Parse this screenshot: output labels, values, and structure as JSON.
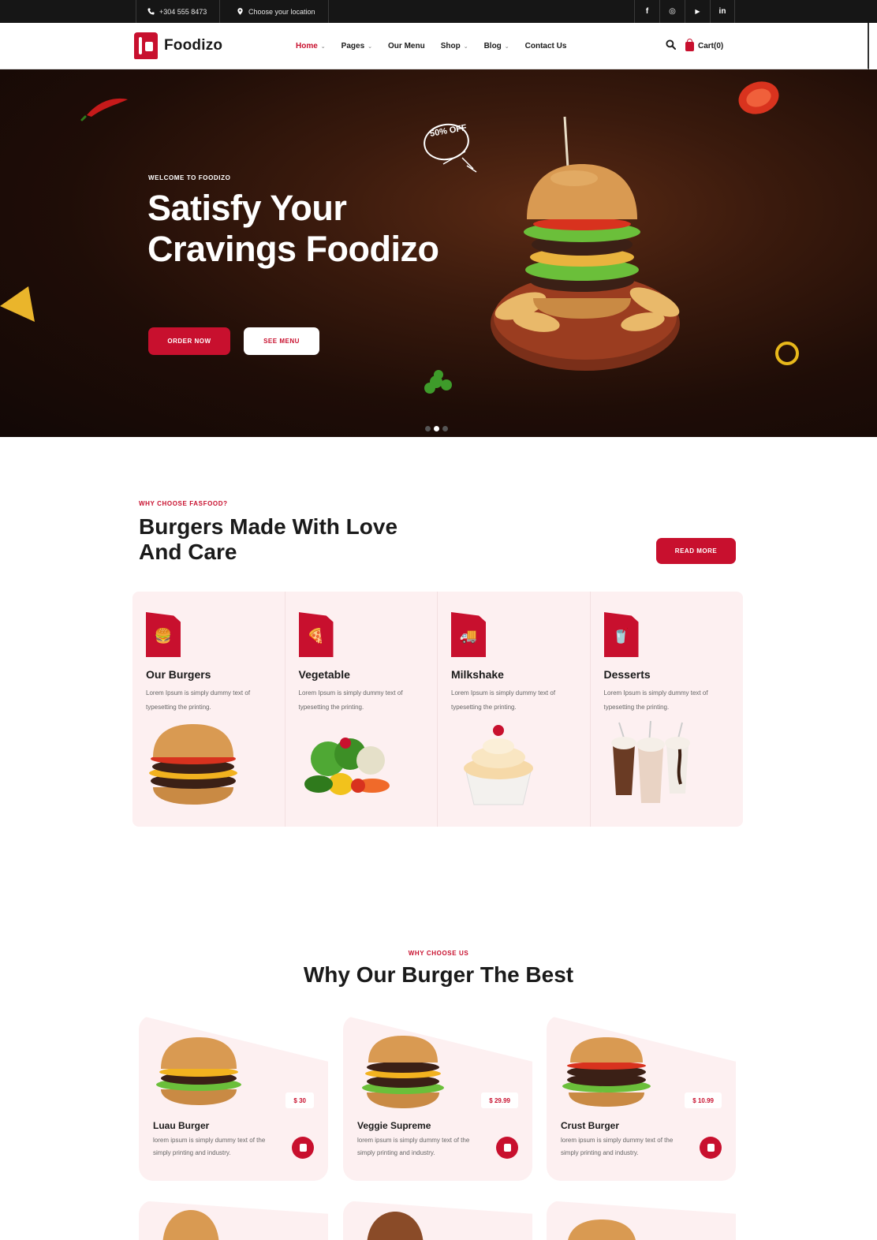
{
  "topbar": {
    "phone": "+304 555 8473",
    "location": "Choose your location",
    "socials": [
      {
        "icon": "facebook-icon",
        "glyph": "f"
      },
      {
        "icon": "instagram-icon",
        "glyph": "◎"
      },
      {
        "icon": "youtube-icon",
        "glyph": "▶"
      },
      {
        "icon": "linkedin-icon",
        "glyph": "in"
      }
    ]
  },
  "nav": {
    "brand": "Foodizo",
    "items": [
      {
        "label": "Home",
        "dropdown": true,
        "active": true
      },
      {
        "label": "Pages",
        "dropdown": true,
        "active": false
      },
      {
        "label": "Our Menu",
        "dropdown": false,
        "active": false
      },
      {
        "label": "Shop",
        "dropdown": true,
        "active": false
      },
      {
        "label": "Blog",
        "dropdown": true,
        "active": false
      },
      {
        "label": "Contact Us",
        "dropdown": false,
        "active": false
      }
    ],
    "cart_label": "Cart(0)"
  },
  "hero": {
    "tagline": "WELCOME TO FOODIZO",
    "title": "Satisfy Your Cravings Foodizo",
    "order_button": "ORDER NOW",
    "menu_button": "SEE MENU",
    "badge": "50% OFF",
    "slides": 3,
    "active_slide": 2
  },
  "why_choose": {
    "tagline": "WHY CHOOSE FASFOOD?",
    "title": "Burgers Made With Love And Care",
    "read_more": "READ MORE",
    "categories": [
      {
        "title": "Our Burgers",
        "desc": "Lorem Ipsum is simply dummy text of typesetting the printing.",
        "icon": "burger-icon",
        "image": "burger-image"
      },
      {
        "title": "Vegetable",
        "desc": "Lorem Ipsum is simply dummy text of typesetting the printing.",
        "icon": "pizza-slice-icon",
        "image": "vegetables-image"
      },
      {
        "title": "Milkshake",
        "desc": "Lorem Ipsum is simply dummy text of typesetting the printing.",
        "icon": "food-truck-icon",
        "image": "cupcake-image"
      },
      {
        "title": "Desserts",
        "desc": "Lorem Ipsum is simply dummy text of typesetting the printing.",
        "icon": "drink-cup-icon",
        "image": "milkshakes-image"
      }
    ]
  },
  "best_burger": {
    "tagline": "WHY CHOOSE US",
    "title": "Why Our Burger The Best",
    "products": [
      {
        "name": "Luau Burger",
        "price": "$ 30",
        "desc": "lorem ipsum is simply dummy text of the simply printing and industry."
      },
      {
        "name": "Veggie Supreme",
        "price": "$ 29.99",
        "desc": "lorem ipsum is simply dummy text of the simply printing and industry."
      },
      {
        "name": "Crust Burger",
        "price": "$ 10.99",
        "desc": "lorem ipsum is simply dummy text of the simply printing and industry."
      }
    ]
  },
  "colors": {
    "accent": "#c8102e",
    "topbar": "#161616",
    "card_bg": "#fdf0f1",
    "hero_dark": "#1f0d07"
  }
}
